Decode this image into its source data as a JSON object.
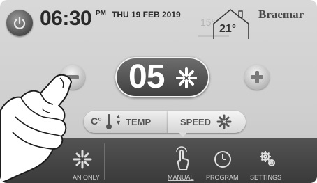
{
  "header": {
    "time": "06:30",
    "ampm": "PM",
    "date": "THU 19 FEB 2019",
    "outdoor_temp": "15°",
    "indoor_temp": "21°",
    "brand": "Braemar"
  },
  "main": {
    "speed_value": "05",
    "toggle": {
      "temp_unit": "C°",
      "temp_label": "TEMP",
      "speed_label": "SPEED"
    }
  },
  "nav": {
    "items": [
      {
        "label": "AN ONLY",
        "icon": "fan-icon"
      },
      {
        "label": "MANUAL",
        "icon": "touch-hand-icon"
      },
      {
        "label": "PROGRAM",
        "icon": "clock-icon"
      },
      {
        "label": "SETTINGS",
        "icon": "gear-icon"
      }
    ]
  },
  "colors": {
    "screen_bg": "#d2d2d2",
    "display_bg": "#4a4a4a",
    "nav_bg": "#464646"
  }
}
